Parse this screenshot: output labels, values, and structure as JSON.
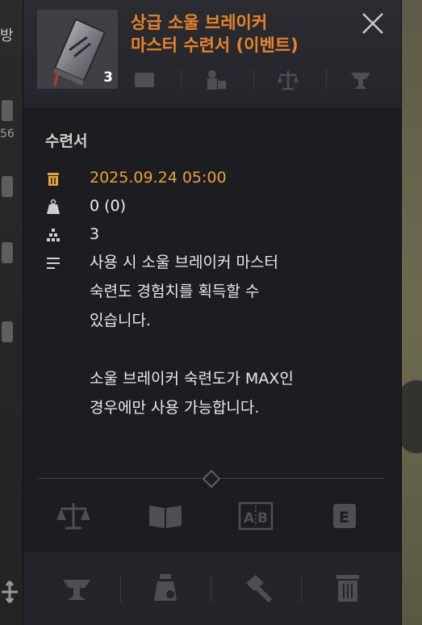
{
  "background": {
    "left_labels": [
      "방"
    ],
    "left_numbers": [
      "56"
    ]
  },
  "item": {
    "title": "상급 소울 브레이커\n마스터 수련서 (이벤트)",
    "count": "3",
    "category": "수련서",
    "expire_date": "2025.09.24 05:00",
    "weight": "0 (0)",
    "quantity": "3",
    "description": "사용 시 소울 브레이커 마스터\n숙련도 경험치를 획득할 수\n있습니다.\n\n소울 브레이커 숙련도가 MAX인\n경우에만 사용 가능합니다."
  },
  "header_icons": [
    "chest-icon",
    "npc-shop-icon",
    "balance-icon",
    "anvil-icon"
  ],
  "action_icons_row1": [
    "balance-icon",
    "book-icon",
    "ab-compare-icon",
    "e-key-icon"
  ],
  "action_icons_row2": [
    "anvil-icon",
    "potion-icon",
    "hammer-icon",
    "trash-icon"
  ],
  "colors": {
    "title": "#e8832a",
    "expire": "#e8a33b",
    "panel": "#1c1d21",
    "icon_dim": "#4d4f55"
  }
}
